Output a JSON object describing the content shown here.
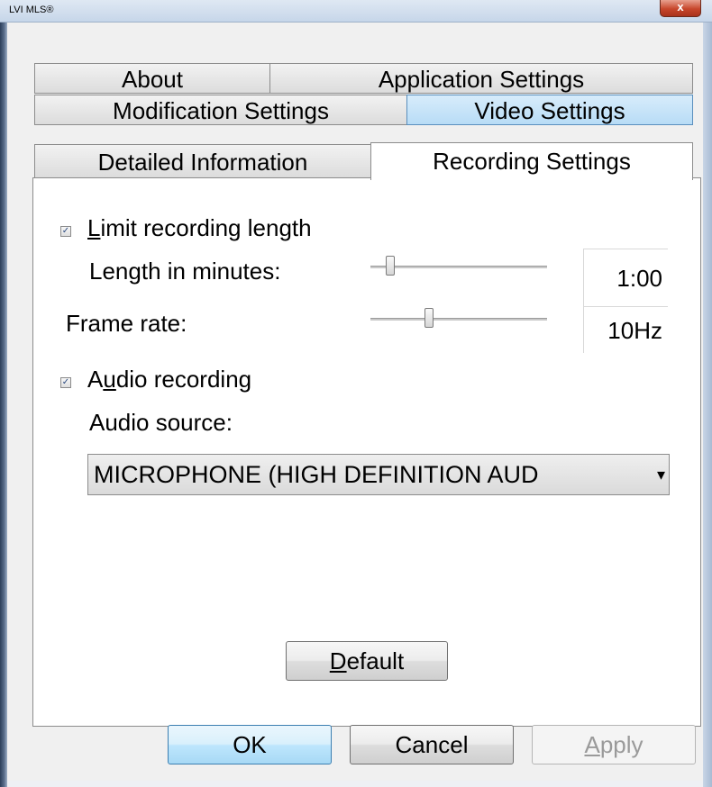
{
  "window": {
    "title": "LVI MLS®",
    "close_glyph": "x"
  },
  "tabs": {
    "row1": [
      {
        "label": "About"
      },
      {
        "label": "Application Settings"
      }
    ],
    "row2": [
      {
        "label": "Modification Settings"
      },
      {
        "label": "Video Settings"
      }
    ],
    "row3": [
      {
        "label": "Detailed Information"
      },
      {
        "label": "Recording Settings"
      }
    ]
  },
  "recording": {
    "limit_label_pre": "",
    "limit_label_u": "L",
    "limit_label_post": "imit recording length",
    "limit_checked": true,
    "length_label": "Length in minutes:",
    "length_value": "1:00",
    "length_slider_fraction": 0.1,
    "frame_rate_label": "Frame rate:",
    "frame_rate_value": "10Hz",
    "frame_rate_slider_fraction": 0.33,
    "audio_label_pre": "A",
    "audio_label_u": "u",
    "audio_label_post": "dio recording",
    "audio_checked": true,
    "audio_source_label": "Audio source:",
    "audio_source_value": "MICROPHONE (HIGH DEFINITION AUD",
    "default_u": "D",
    "default_rest": "efault"
  },
  "footer": {
    "ok_label": "OK",
    "cancel_label": "Cancel",
    "apply_u": "A",
    "apply_rest": "pply"
  },
  "colors": {
    "tab_highlight": "#b8dcf6",
    "close_button": "#c7462b"
  }
}
